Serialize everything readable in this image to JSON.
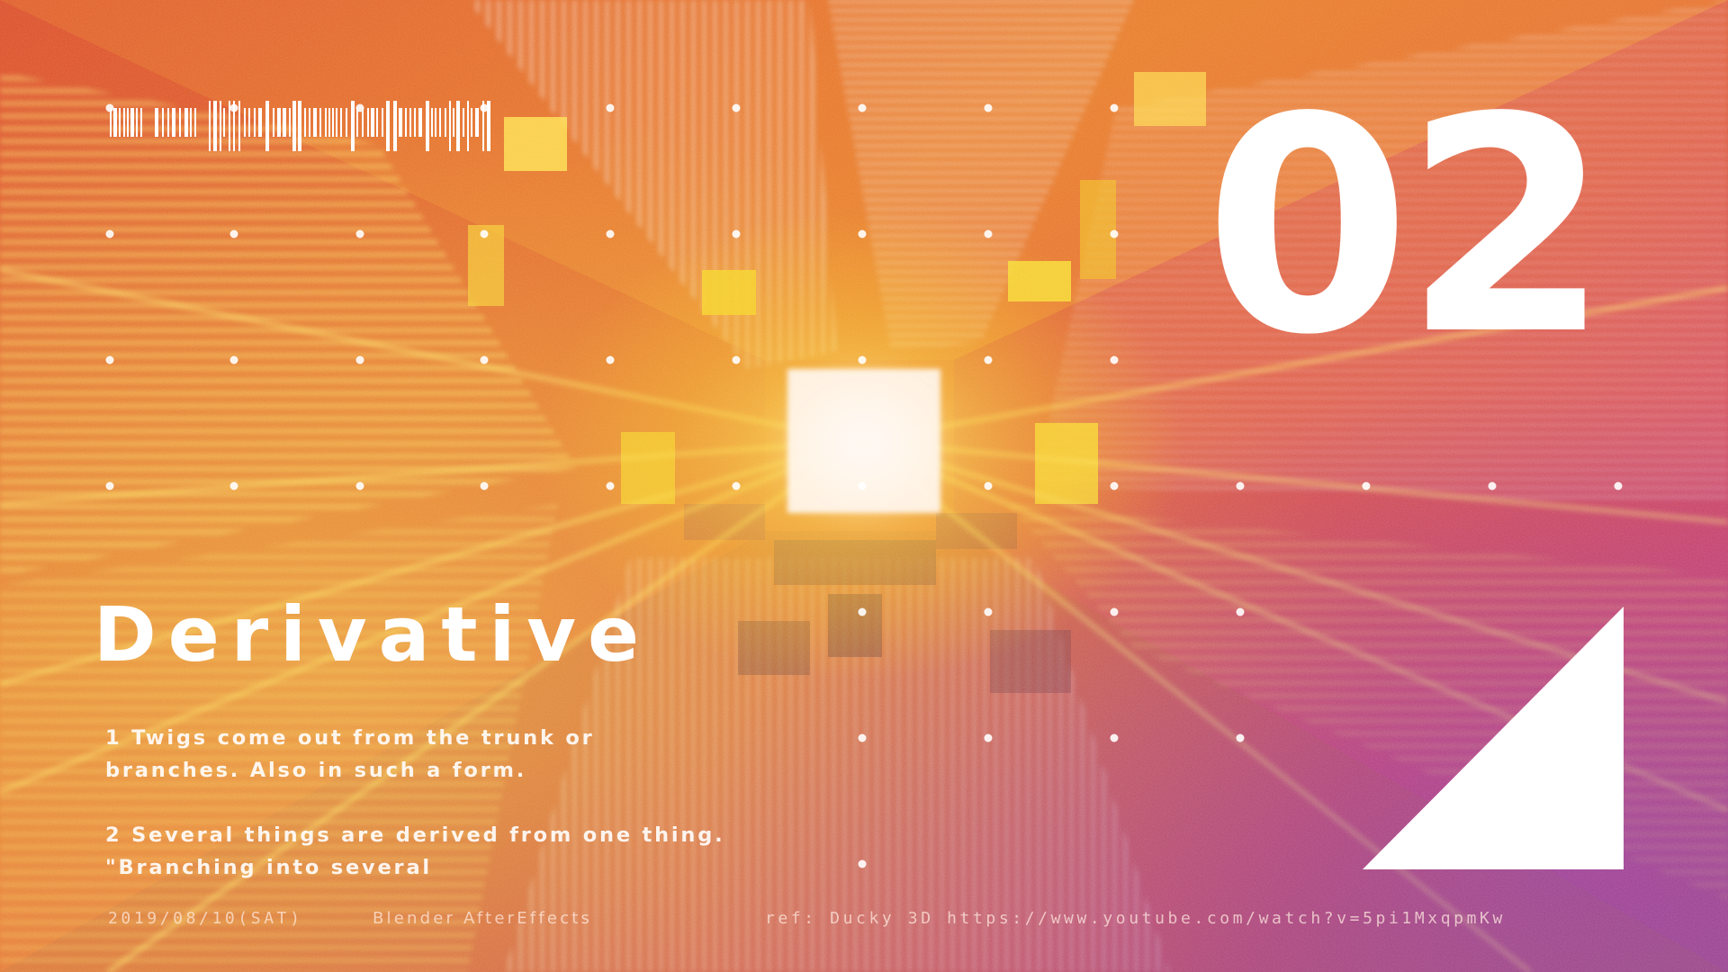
{
  "artwork": {
    "number": "02",
    "title": "Derivative",
    "definitions": [
      "1 Twigs come out from the trunk or branches. Also in such a form.",
      "2 Several things are derived from one thing. \"Branching into several"
    ],
    "date": "2019/08/10(SAT)",
    "tools": "Blender AfterEffects",
    "reference": "ref: Ducky 3D https://www.youtube.com/watch?v=5pi1MxqpmKw"
  },
  "colors": {
    "text": "#ffffff",
    "warm_red": "#d23a2a",
    "orange": "#f28a1a",
    "yellow": "#f5d81a",
    "magenta": "#c2307a",
    "violet": "#7a3aa0",
    "core_glow": "#fff7f0"
  },
  "icons": {
    "barcode": "barcode-graphic",
    "triangle": "right-triangle-shape",
    "dot_grid": "dot-grid-pattern"
  }
}
